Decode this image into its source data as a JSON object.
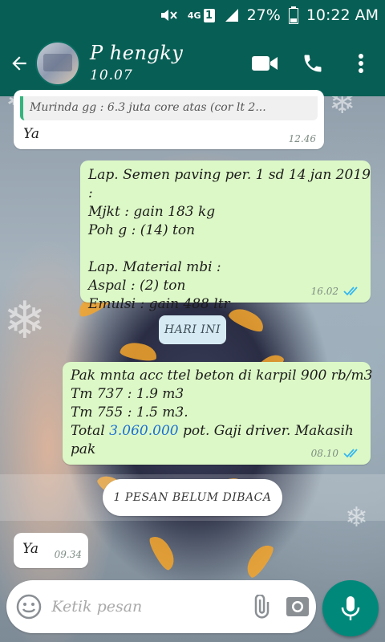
{
  "status_bar": {
    "network": "4G",
    "sim": "1",
    "battery": "27%",
    "time": "10:22 AM"
  },
  "header": {
    "contact_name": "P hengky",
    "contact_status": "10.07"
  },
  "messages": [
    {
      "direction": "in",
      "quote": "Murinda gg : 6.3 juta core atas (cor lt 2...",
      "text": "Ya",
      "time": "12.46"
    },
    {
      "direction": "out",
      "text": "Lap. Semen paving per. 1 sd 14 jan 2019 :\nMjkt : gain 183 kg\nPoh g : (14) ton\n\nLap. Material mbi :\nAspal : (2) ton\nEmulsi : gain 488 ltr",
      "time": "16.02",
      "read": true
    },
    {
      "direction": "out",
      "text_line1": "Pak mnta acc ttel beton di karpil 900 rb/m3",
      "text_line2": "Tm 737 : 1.9 m3",
      "text_line3": "Tm 755 : 1.5 m3.",
      "text_line4_pre": "Total ",
      "text_line4_link": "3.060.000",
      "text_line4_post": " pot. Gaji driver. Makasih",
      "text_line5": "pak",
      "time": "08.10",
      "read": true
    },
    {
      "direction": "in",
      "text": "Ya",
      "time": "09.34"
    }
  ],
  "date_chip": "HARI INI",
  "unread_banner": "1 PESAN BELUM DIBACA",
  "composer": {
    "placeholder": "Ketik pesan"
  },
  "colors": {
    "header": "#075e54",
    "outgoing_bubble": "#dcf8c6",
    "incoming_bubble": "#ffffff",
    "read_ticks": "#34b7f1",
    "mic_button": "#00897b"
  },
  "icons": {
    "back": "arrow-left",
    "video": "video-camera",
    "call": "phone",
    "menu": "more-vertical",
    "emoji": "smiley",
    "attach": "paperclip",
    "camera": "camera",
    "mic": "microphone"
  }
}
